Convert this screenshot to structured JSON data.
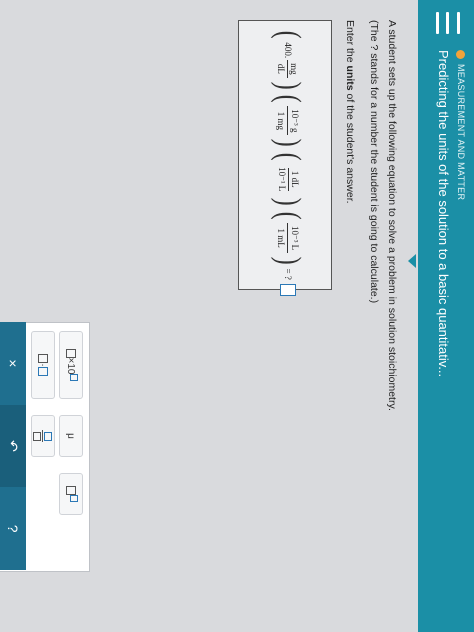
{
  "header": {
    "topic": "MEASUREMENT AND MATTER",
    "title": "Predicting the units of the solution to a basic quantitativ..."
  },
  "problem": {
    "line1": "A student sets up the following equation to solve a problem in solution stoichiometry.",
    "line2": "(The ? stands for a number the student is going to calculate.)",
    "enter_prefix": "Enter the ",
    "enter_bold": "units",
    "enter_suffix": " of the student's answer."
  },
  "equation": {
    "coef": "400.",
    "f1_num": "mg",
    "f1_den": "dL",
    "f2_num": "10⁻³ g",
    "f2_den": "1 mg",
    "f3_num": "1 dL",
    "f3_den": "10⁻¹ L",
    "f4_num": "10⁻³ L",
    "f4_den": "1 mL",
    "equals": "= ?"
  },
  "keypad": {
    "sci": "×10",
    "mu": "μ",
    "dot": "·"
  },
  "actions": {
    "clear": "×",
    "undo": "↶",
    "help": "?"
  },
  "colors": {
    "header_bg": "#1b8fa6",
    "accent_orange": "#f2a33a",
    "input_blue": "#2b78b6"
  }
}
